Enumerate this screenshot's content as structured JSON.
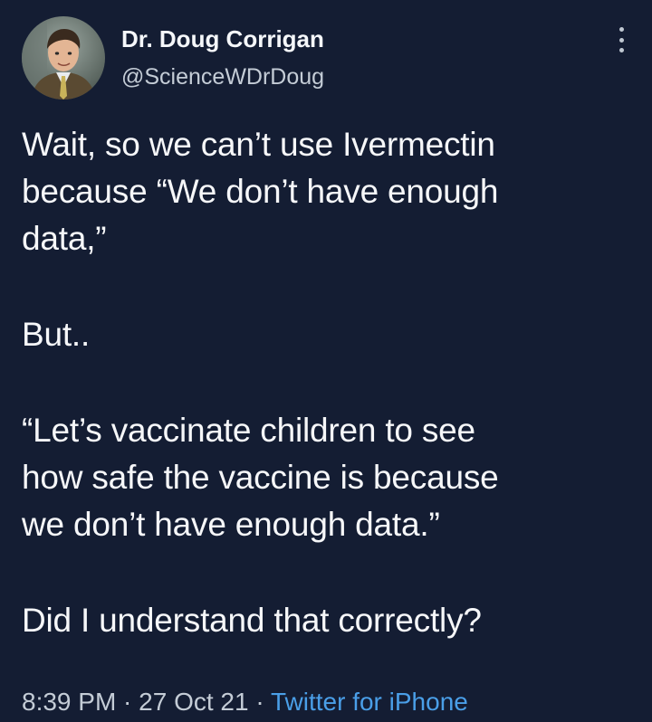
{
  "author": {
    "display_name": "Dr. Doug Corrigan",
    "handle": "@ScienceWDrDoug",
    "avatar_icon": "profile-photo"
  },
  "tweet": {
    "paragraphs": [
      "Wait, so we can’t use Ivermectin\nbecause “We don’t have enough\ndata,”",
      "But..",
      "“Let’s vaccinate children to see\nhow safe the vaccine is because\nwe don’t have enough data.”",
      "Did I understand that correctly?"
    ]
  },
  "meta": {
    "time": "8:39 PM",
    "separator": " · ",
    "date": "27 Oct 21",
    "source": "Twitter for iPhone"
  },
  "colors": {
    "background": "#141d33",
    "text": "#f6f7f9",
    "secondary": "#c4ccd6",
    "link": "#4a9fe8"
  }
}
